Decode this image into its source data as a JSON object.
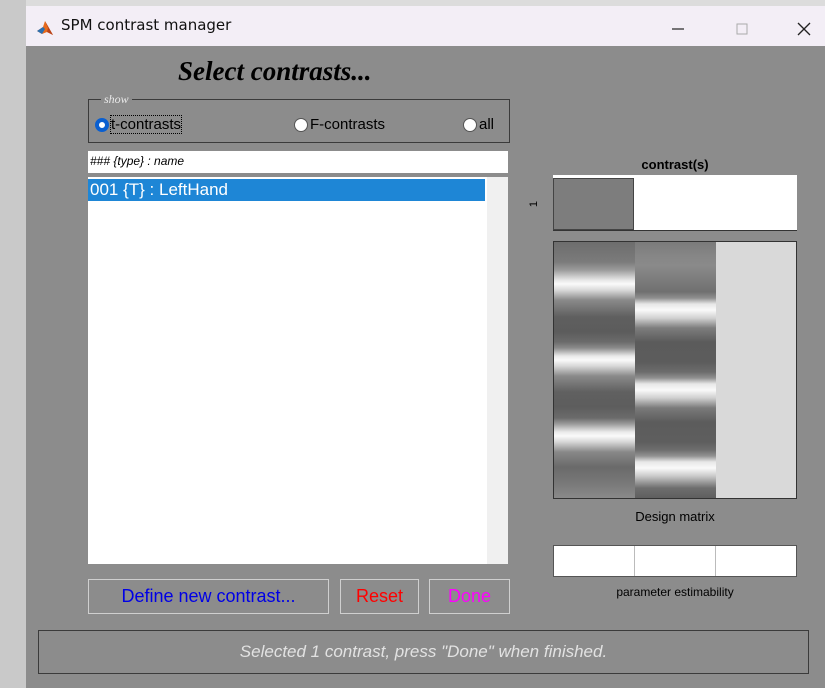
{
  "window": {
    "title": "SPM contrast manager",
    "controls": {
      "minimize": "minimize-icon",
      "maximize": "maximize-icon",
      "close": "close-icon"
    }
  },
  "heading": "Select contrasts...",
  "show_group": {
    "legend": "show",
    "options": [
      {
        "label": "t-contrasts",
        "selected": true
      },
      {
        "label": "F-contrasts",
        "selected": false
      },
      {
        "label": "all",
        "selected": false
      }
    ]
  },
  "contrast_list": {
    "header": "### {type} : name",
    "items": [
      {
        "label": "001 {T} : LeftHand",
        "selected": true
      }
    ]
  },
  "buttons": {
    "define": "Define new contrast...",
    "reset": "Reset",
    "done": "Done"
  },
  "status": "Selected 1 contrast, press \"Done\" when finished.",
  "contrast_panel": {
    "title": "contrast(s)",
    "row_label": "1",
    "weights": [
      1,
      0,
      0
    ]
  },
  "design_matrix": {
    "label": "Design matrix",
    "columns": 3
  },
  "estimability": {
    "label": "parameter estimability",
    "cells": 3
  },
  "colors": {
    "selection": "#1e86d6",
    "radio_selected": "#0a5fd0",
    "define_text": "#0000e6",
    "reset_text": "#ff0000",
    "done_text": "#ff00ff",
    "background": "#8c8c8c"
  }
}
